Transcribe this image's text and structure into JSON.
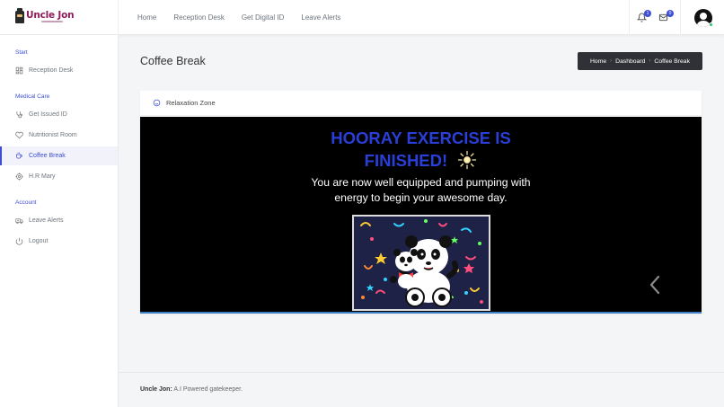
{
  "brand": {
    "name": "Uncle Jon"
  },
  "topnav": {
    "items": [
      {
        "label": "Home"
      },
      {
        "label": "Reception Desk"
      },
      {
        "label": "Get Digital ID"
      },
      {
        "label": "Leave Alerts"
      }
    ]
  },
  "notifications": {
    "bell_count": "1",
    "mail_count": "0"
  },
  "sidebar": {
    "sections": [
      {
        "title": "Start",
        "items": [
          {
            "label": "Reception Desk",
            "icon": "grid-icon"
          }
        ]
      },
      {
        "title": "Medical Care",
        "items": [
          {
            "label": "Get Issued ID",
            "icon": "stethoscope-icon"
          },
          {
            "label": "Nutritionist Room",
            "icon": "heart-icon"
          },
          {
            "label": "Coffee Break",
            "icon": "coffee-icon",
            "active": true
          },
          {
            "label": "H.R Mary",
            "icon": "gear-icon"
          }
        ]
      },
      {
        "title": "Account",
        "items": [
          {
            "label": "Leave Alerts",
            "icon": "ambulance-icon"
          },
          {
            "label": "Logout",
            "icon": "power-icon"
          }
        ]
      }
    ]
  },
  "page": {
    "title": "Coffee Break"
  },
  "breadcrumb": {
    "items": [
      "Home",
      "Dashboard",
      "Coffee Break"
    ]
  },
  "card": {
    "header": "Relaxation Zone",
    "headline_line1": "HOORAY EXERCISE IS",
    "headline_line2": "FINISHED!",
    "sub_line1": "You are now well equipped and pumping with",
    "sub_line2": "energy to begin your awesome day."
  },
  "footer": {
    "brand": "Uncle Jon:",
    "text": " A.I Powered gatekeeper."
  },
  "colors": {
    "accent": "#3d4fd3",
    "brand": "#8e1b5a",
    "headline": "#2a3fd8"
  }
}
